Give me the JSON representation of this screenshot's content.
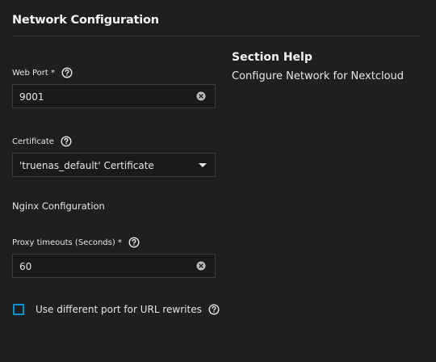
{
  "section": {
    "title": "Network Configuration"
  },
  "fields": {
    "web_port": {
      "label": "Web Port *",
      "value": "9001"
    },
    "certificate": {
      "label": "Certificate",
      "value": "'truenas_default' Certificate"
    },
    "nginx_heading": "Nginx Configuration",
    "proxy_timeout": {
      "label": "Proxy timeouts (Seconds) *",
      "value": "60"
    },
    "url_rewrite": {
      "label": "Use different port for URL rewrites",
      "checked": false
    }
  },
  "help": {
    "title": "Section Help",
    "text": "Configure Network for Nextcloud"
  },
  "colors": {
    "background": "#1f1f1f",
    "accent": "#0095d5",
    "text": "#e6e6e6"
  },
  "icons": {
    "help": "help-circle-icon",
    "clear": "clear-circle-icon",
    "dropdown": "caret-down-icon"
  }
}
